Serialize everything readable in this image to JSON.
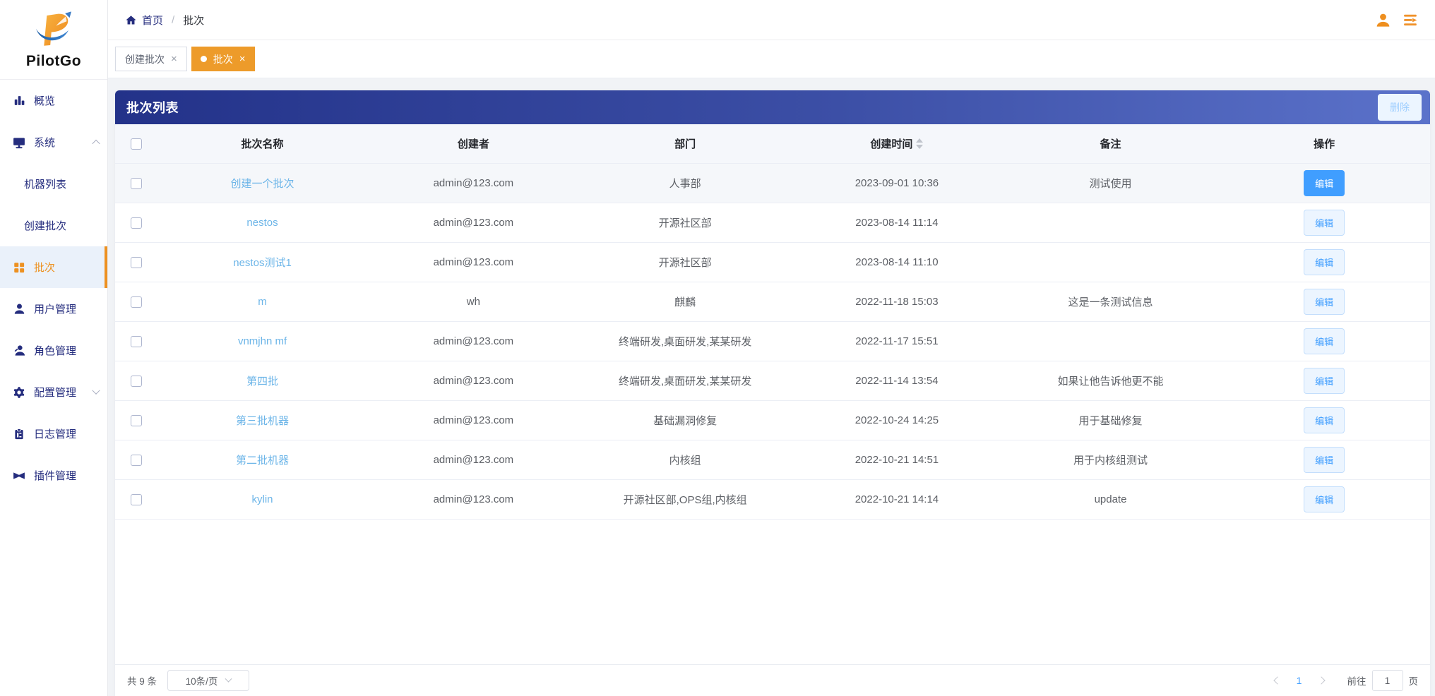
{
  "brand": {
    "name": "PilotGo"
  },
  "breadcrumb": {
    "home": "首页",
    "separator": "/",
    "current": "批次"
  },
  "tabs": {
    "close_glyph": "×",
    "items": [
      {
        "label": "创建批次",
        "active": false
      },
      {
        "label": "批次",
        "active": true
      }
    ]
  },
  "sidebar": {
    "items": [
      {
        "label": "概览",
        "icon": "bar-chart-icon"
      },
      {
        "label": "系统",
        "icon": "monitor-icon",
        "state": "expanded"
      },
      {
        "label": "机器列表",
        "type": "sub"
      },
      {
        "label": "创建批次",
        "type": "sub"
      },
      {
        "label": "批次",
        "type": "sub",
        "icon": "grid-icon",
        "active": true
      },
      {
        "label": "用户管理",
        "icon": "user-icon"
      },
      {
        "label": "角色管理",
        "icon": "role-icon"
      },
      {
        "label": "配置管理",
        "icon": "gear-icon",
        "state": "collapsed"
      },
      {
        "label": "日志管理",
        "icon": "clipboard-icon"
      },
      {
        "label": "插件管理",
        "icon": "plugin-icon"
      }
    ]
  },
  "panel": {
    "title": "批次列表",
    "delete_label": "删除"
  },
  "table": {
    "columns": [
      "",
      "批次名称",
      "创建者",
      "部门",
      "创建时间",
      "备注",
      "操作"
    ],
    "edit_label": "编辑",
    "rows": [
      {
        "name": "创建一个批次",
        "creator": "admin@123.com",
        "dept": "人事部",
        "time": "2023-09-01 10:36",
        "remark": "测试使用"
      },
      {
        "name": "nestos",
        "creator": "admin@123.com",
        "dept": "开源社区部",
        "time": "2023-08-14 11:14",
        "remark": ""
      },
      {
        "name": "nestos测试1",
        "creator": "admin@123.com",
        "dept": "开源社区部",
        "time": "2023-08-14 11:10",
        "remark": ""
      },
      {
        "name": "m",
        "creator": "wh",
        "dept": "麒麟",
        "time": "2022-11-18 15:03",
        "remark": "这是一条测试信息"
      },
      {
        "name": "vnmjhn mf",
        "creator": "admin@123.com",
        "dept": "终端研发,桌面研发,某某研发",
        "time": "2022-11-17 15:51",
        "remark": ""
      },
      {
        "name": "第四批",
        "creator": "admin@123.com",
        "dept": "终端研发,桌面研发,某某研发",
        "time": "2022-11-14 13:54",
        "remark": "如果让他告诉他更不能"
      },
      {
        "name": "第三批机器",
        "creator": "admin@123.com",
        "dept": "基础漏洞修复",
        "time": "2022-10-24 14:25",
        "remark": "用于基础修复"
      },
      {
        "name": "第二批机器",
        "creator": "admin@123.com",
        "dept": "内核组",
        "time": "2022-10-21 14:51",
        "remark": "用于内核组测试"
      },
      {
        "name": "kylin",
        "creator": "admin@123.com",
        "dept": "开源社区部,OPS组,内核组",
        "time": "2022-10-21 14:14",
        "remark": "update"
      }
    ]
  },
  "pagination": {
    "total_label": "共 9 条",
    "page_size_label": "10条/页",
    "current_page": "1",
    "goto_label": "前往",
    "goto_value": "1",
    "page_unit": "页"
  },
  "colors": {
    "accent_orange": "#ed9b2a",
    "sidebar_navy": "#252d7e",
    "panel_gradient_start": "#233289",
    "panel_gradient_end": "#5b72ca",
    "link_blue": "#6cb5e8",
    "primary_blue": "#409eff"
  }
}
